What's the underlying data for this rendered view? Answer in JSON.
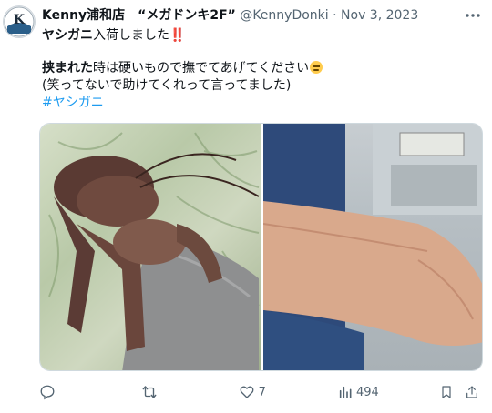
{
  "tweet": {
    "author_name": "Kenny浦和店　“メガドンキ2F”",
    "handle": "@KennyDonki",
    "separator": "·",
    "date": "Nov 3, 2023",
    "line1_bold": "ヤシガニ",
    "line1_rest": "入荷しました",
    "line1_emoji": "‼️",
    "line2_bold": "挟まれた",
    "line2_rest": "時は硬いもので撫でてあげてください",
    "line3": "(笑ってないで助けてくれって言ってました)",
    "hashtag": "#ヤシガニ",
    "avatar_text": "K"
  },
  "actions": {
    "reply": {
      "icon": "reply-icon",
      "count": ""
    },
    "retweet": {
      "icon": "retweet-icon",
      "count": ""
    },
    "like": {
      "icon": "heart-icon",
      "count": "7"
    },
    "views": {
      "icon": "views-icon",
      "count": "494"
    },
    "bookmark": {
      "icon": "bookmark-icon"
    },
    "share": {
      "icon": "share-icon"
    }
  },
  "colors": {
    "text": "#0f1419",
    "meta": "#536471",
    "link": "#1d9bf0",
    "exclaim": "#e0245e"
  }
}
